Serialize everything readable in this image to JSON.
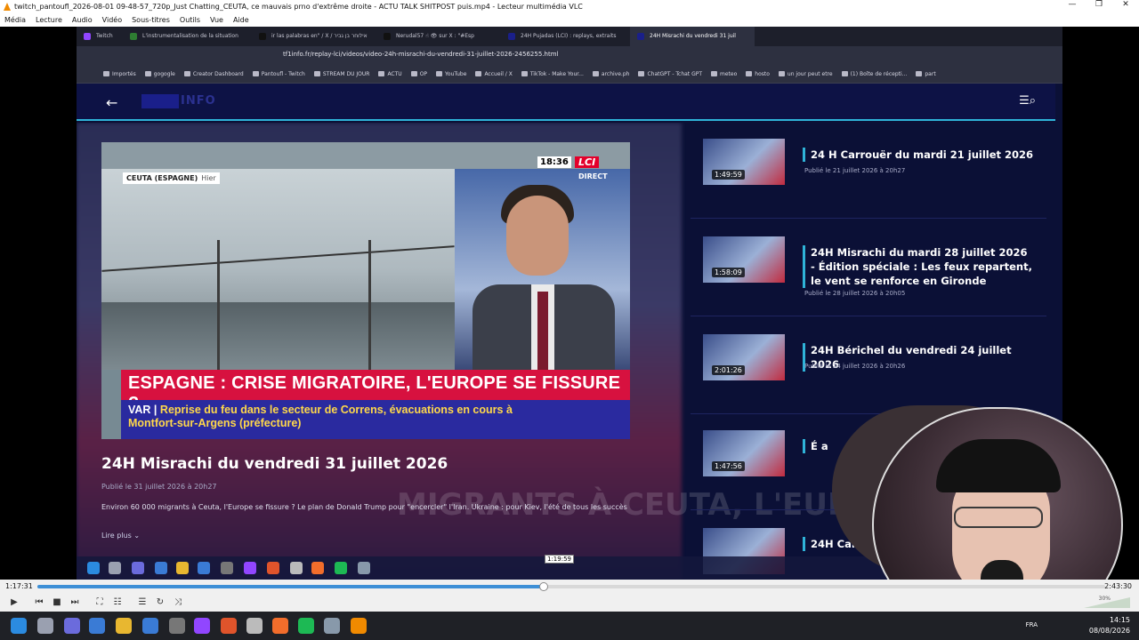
{
  "vlc": {
    "title": "twitch_pantoufl_2026-08-01 09-48-57_720p_Just Chatting_CEUTA, ce mauvais prno d'extrême droite - ACTU TALK SHITPOST puis.mp4 - Lecteur multimédia VLC",
    "menu": [
      "Média",
      "Lecture",
      "Audio",
      "Vidéo",
      "Sous-titres",
      "Outils",
      "Vue",
      "Aide"
    ],
    "time_elapsed": "1:17:31",
    "time_total": "2:43:30",
    "seek_tooltip": "1:19:59",
    "progress_fraction": 0.474,
    "volume_label": "30%"
  },
  "browser": {
    "tabs": [
      {
        "label": "Twitch",
        "color": "#9146ff"
      },
      {
        "label": "L'instrumentalisation de la situation",
        "color": "#2e7d32"
      },
      {
        "label": "ir las palabras en\" / X  / אילוחר בן גביר",
        "color": "#111111"
      },
      {
        "label": "Nerudal57 ☝ 👁 sur X : \"#Esp",
        "color": "#111111"
      },
      {
        "label": "24H Pujadas (LCI) : replays, extraits",
        "color": "#1a1f8a"
      },
      {
        "label": "24H Misrachi du vendredi 31 juil",
        "color": "#1a1f8a"
      }
    ],
    "url": "tf1info.fr/replay-lci/videos/video-24h-misrachi-du-vendredi-31-juillet-2026-2456255.html",
    "bookmarks": [
      "Importés",
      "gogogle",
      "Creator Dashboard",
      "Pantoufl - Twitch",
      "STREAM DU JOUR",
      "ACTU",
      "OP",
      "YouTube",
      "Accueil / X",
      "TikTok - Make Your...",
      "archive.ph",
      "ChatGPT - Tchat GPT",
      "meteo",
      "hosto",
      "un jour peut etre",
      "(1) Boîte de récepti...",
      "part"
    ]
  },
  "site": {
    "logo_text": "INFO",
    "player": {
      "location": "CEUTA (ESPAGNE)",
      "when": "Hier",
      "clock": "18:36",
      "channel": "LCI",
      "live": "DIRECT",
      "headline": "ESPAGNE : CRISE MIGRATOIRE, L'EUROPE SE FISSURE ?",
      "ticker_tag": "VAR |",
      "ticker_text": "Reprise du feu dans le secteur de Correns, évacuations en cours à Montfort-sur-Argens (préfecture)"
    },
    "background_text": "MIGRANTS À CEUTA, L'EUR",
    "video_title": "24H Misrachi du vendredi 31 juillet 2026",
    "video_date": "Publié le 31 juillet 2026 à 20h27",
    "video_desc": "Environ 60 000 migrants à Ceuta, l'Europe se fissure ? Le plan de Donald Trump pour \"encercler\" l'Iran. Ukraine : pour Kiev, l'été de tous les succès",
    "read_more": "Lire plus ⌄",
    "related": [
      {
        "duration": "1:49:59",
        "title": "24 H Carrouër du mardi 21 juillet 2026",
        "date": "Publié le 21 juillet 2026 à 20h27"
      },
      {
        "duration": "1:58:09",
        "title": "24H Misrachi du mardi 28 juillet 2026 - Édition spéciale : Les feux repartent, le vent se renforce en Gironde",
        "date": "Publié le 28 juillet 2026 à 20h05"
      },
      {
        "duration": "2:01:26",
        "title": "24H Bérichel du vendredi 24 juillet 2026",
        "date": "Publié le 24 juillet 2026 à 20h26"
      },
      {
        "duration": "1:47:56",
        "title": "É a",
        "date": ""
      },
      {
        "duration": "",
        "title": "24H Carrouë",
        "date": ""
      }
    ]
  },
  "taskbar": {
    "lang": "FRA",
    "time": "14:15",
    "date": "08/08/2026"
  }
}
